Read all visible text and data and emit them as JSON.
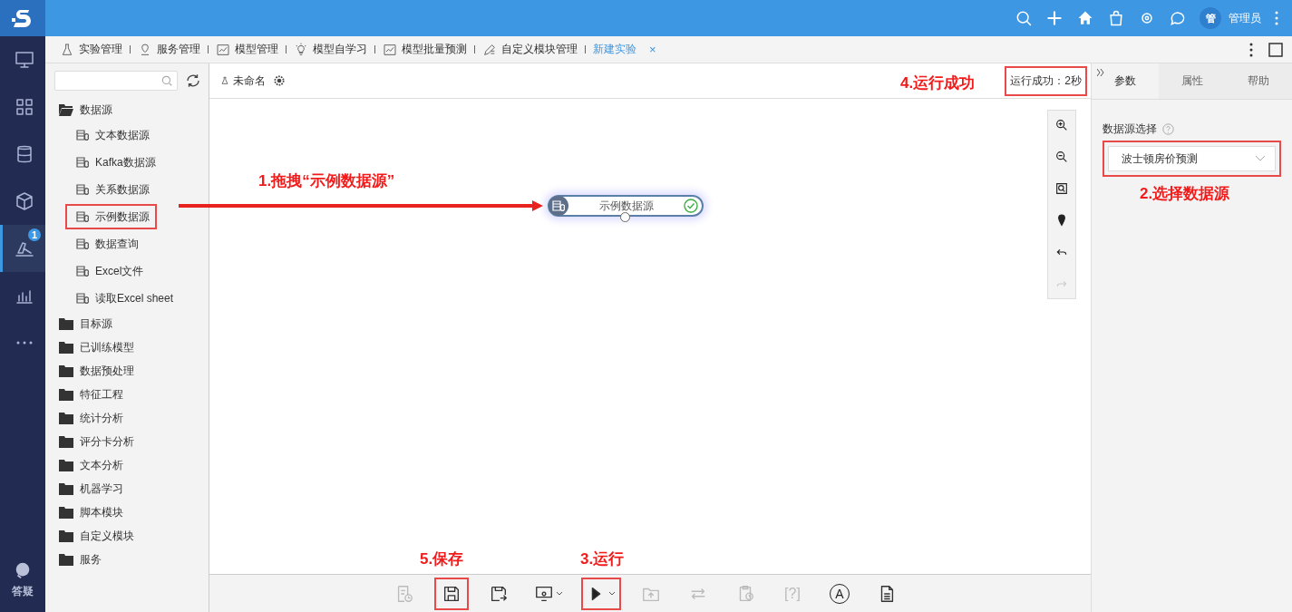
{
  "topbar": {
    "avatar": "管",
    "user": "管理员"
  },
  "nav": {
    "items": [
      {
        "selected": false
      },
      {
        "selected": false
      },
      {
        "selected": false
      },
      {
        "selected": false
      },
      {
        "selected": true,
        "badge": "1"
      },
      {
        "selected": false
      },
      {
        "selected": false
      }
    ],
    "help": "答疑"
  },
  "tabs": [
    {
      "label": "实验管理",
      "selected": false
    },
    {
      "label": "服务管理",
      "selected": false
    },
    {
      "label": "模型管理",
      "selected": false
    },
    {
      "label": "模型自学习",
      "selected": false
    },
    {
      "label": "模型批量预测",
      "selected": false
    },
    {
      "label": "自定义模块管理",
      "selected": false
    },
    {
      "label": "新建实验",
      "selected": true,
      "close": "×"
    }
  ],
  "tree": [
    {
      "label": "数据源",
      "expanded": true,
      "children": [
        {
          "label": "文本数据源",
          "highlighted": false
        },
        {
          "label": "Kafka数据源",
          "highlighted": false
        },
        {
          "label": "关系数据源",
          "highlighted": false
        },
        {
          "label": "示例数据源",
          "highlighted": true
        },
        {
          "label": "数据查询",
          "highlighted": false
        },
        {
          "label": "Excel文件",
          "highlighted": false
        },
        {
          "label": "读取Excel sheet",
          "highlighted": false
        }
      ]
    },
    {
      "label": "目标源",
      "expanded": false
    },
    {
      "label": "已训练模型",
      "expanded": false
    },
    {
      "label": "数据预处理",
      "expanded": false
    },
    {
      "label": "特征工程",
      "expanded": false
    },
    {
      "label": "统计分析",
      "expanded": false
    },
    {
      "label": "评分卡分析",
      "expanded": false
    },
    {
      "label": "文本分析",
      "expanded": false
    },
    {
      "label": "机器学习",
      "expanded": false
    },
    {
      "label": "脚本模块",
      "expanded": false
    },
    {
      "label": "自定义模块",
      "expanded": false
    },
    {
      "label": "服务",
      "expanded": false
    }
  ],
  "canvas": {
    "title": "未命名",
    "status": {
      "text": "运行成功：2秒",
      "highlighted": true
    },
    "node": {
      "label": "示例数据源",
      "success": true
    },
    "zoom_tools": [
      {
        "disabled": false
      },
      {
        "disabled": false
      },
      {
        "disabled": false
      },
      {
        "disabled": false
      },
      {
        "disabled": false
      },
      {
        "disabled": true
      }
    ],
    "toolbar": [
      {
        "disabled": true,
        "highlighted": false
      },
      {
        "disabled": false,
        "highlighted": true
      },
      {
        "disabled": false,
        "highlighted": false
      },
      {
        "disabled": false,
        "highlighted": false
      },
      {
        "disabled": false,
        "highlighted": true
      },
      {
        "disabled": true,
        "highlighted": false
      },
      {
        "disabled": true,
        "highlighted": false
      },
      {
        "disabled": true,
        "highlighted": false
      },
      {
        "disabled": true,
        "highlighted": false,
        "label": "[?]"
      },
      {
        "disabled": false,
        "highlighted": false,
        "label": "A"
      },
      {
        "disabled": false,
        "highlighted": false
      }
    ]
  },
  "panel": {
    "tabs": [
      {
        "label": "参数",
        "selected": true
      },
      {
        "label": "属性",
        "selected": false
      },
      {
        "label": "帮助",
        "selected": false
      }
    ],
    "field_label": "数据源选择",
    "select": {
      "value": "波士顿房价预测",
      "highlighted": true
    }
  },
  "annotations": [
    {
      "kind": "drag",
      "text": "1.拖拽“示例数据源”"
    },
    {
      "kind": "select",
      "text": "2.选择数据源"
    },
    {
      "kind": "run",
      "text": "3.运行"
    },
    {
      "kind": "status",
      "text": "4.运行成功"
    },
    {
      "kind": "save",
      "text": "5.保存"
    }
  ]
}
